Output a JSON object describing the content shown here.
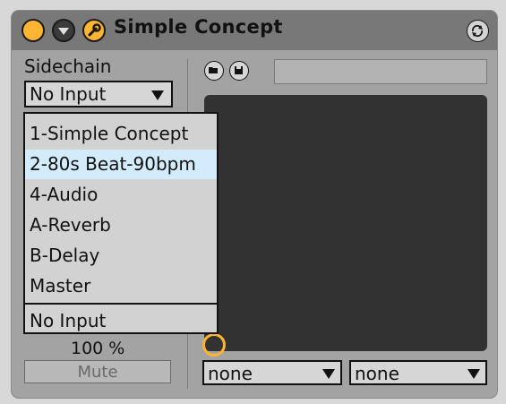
{
  "device": {
    "title": "Simple Concept",
    "icons": {
      "power": "power-icon",
      "fold": "fold-icon",
      "wrench": "wrench-icon",
      "hot_swap": "hot-swap-icon",
      "open": "folder-open-icon",
      "save": "save-icon"
    },
    "colors": {
      "accent": "#ffb532",
      "title_bar": "#787878",
      "body": "#a3a3a3",
      "display": "#323232",
      "highlight": "#d3ecfb"
    }
  },
  "sidechain": {
    "label": "Sidechain",
    "selected": "No Input",
    "gain": "100 %",
    "mute_label": "Mute"
  },
  "menu": {
    "items": [
      "1-Simple Concept",
      "2-80s Beat-90bpm",
      "4-Audio",
      "A-Reverb",
      "B-Delay",
      "Master"
    ],
    "highlighted": "2-80s Beat-90bpm",
    "none_item": "No Input"
  },
  "main": {
    "preset_name": "",
    "selector_1": "none",
    "selector_2": "none"
  }
}
